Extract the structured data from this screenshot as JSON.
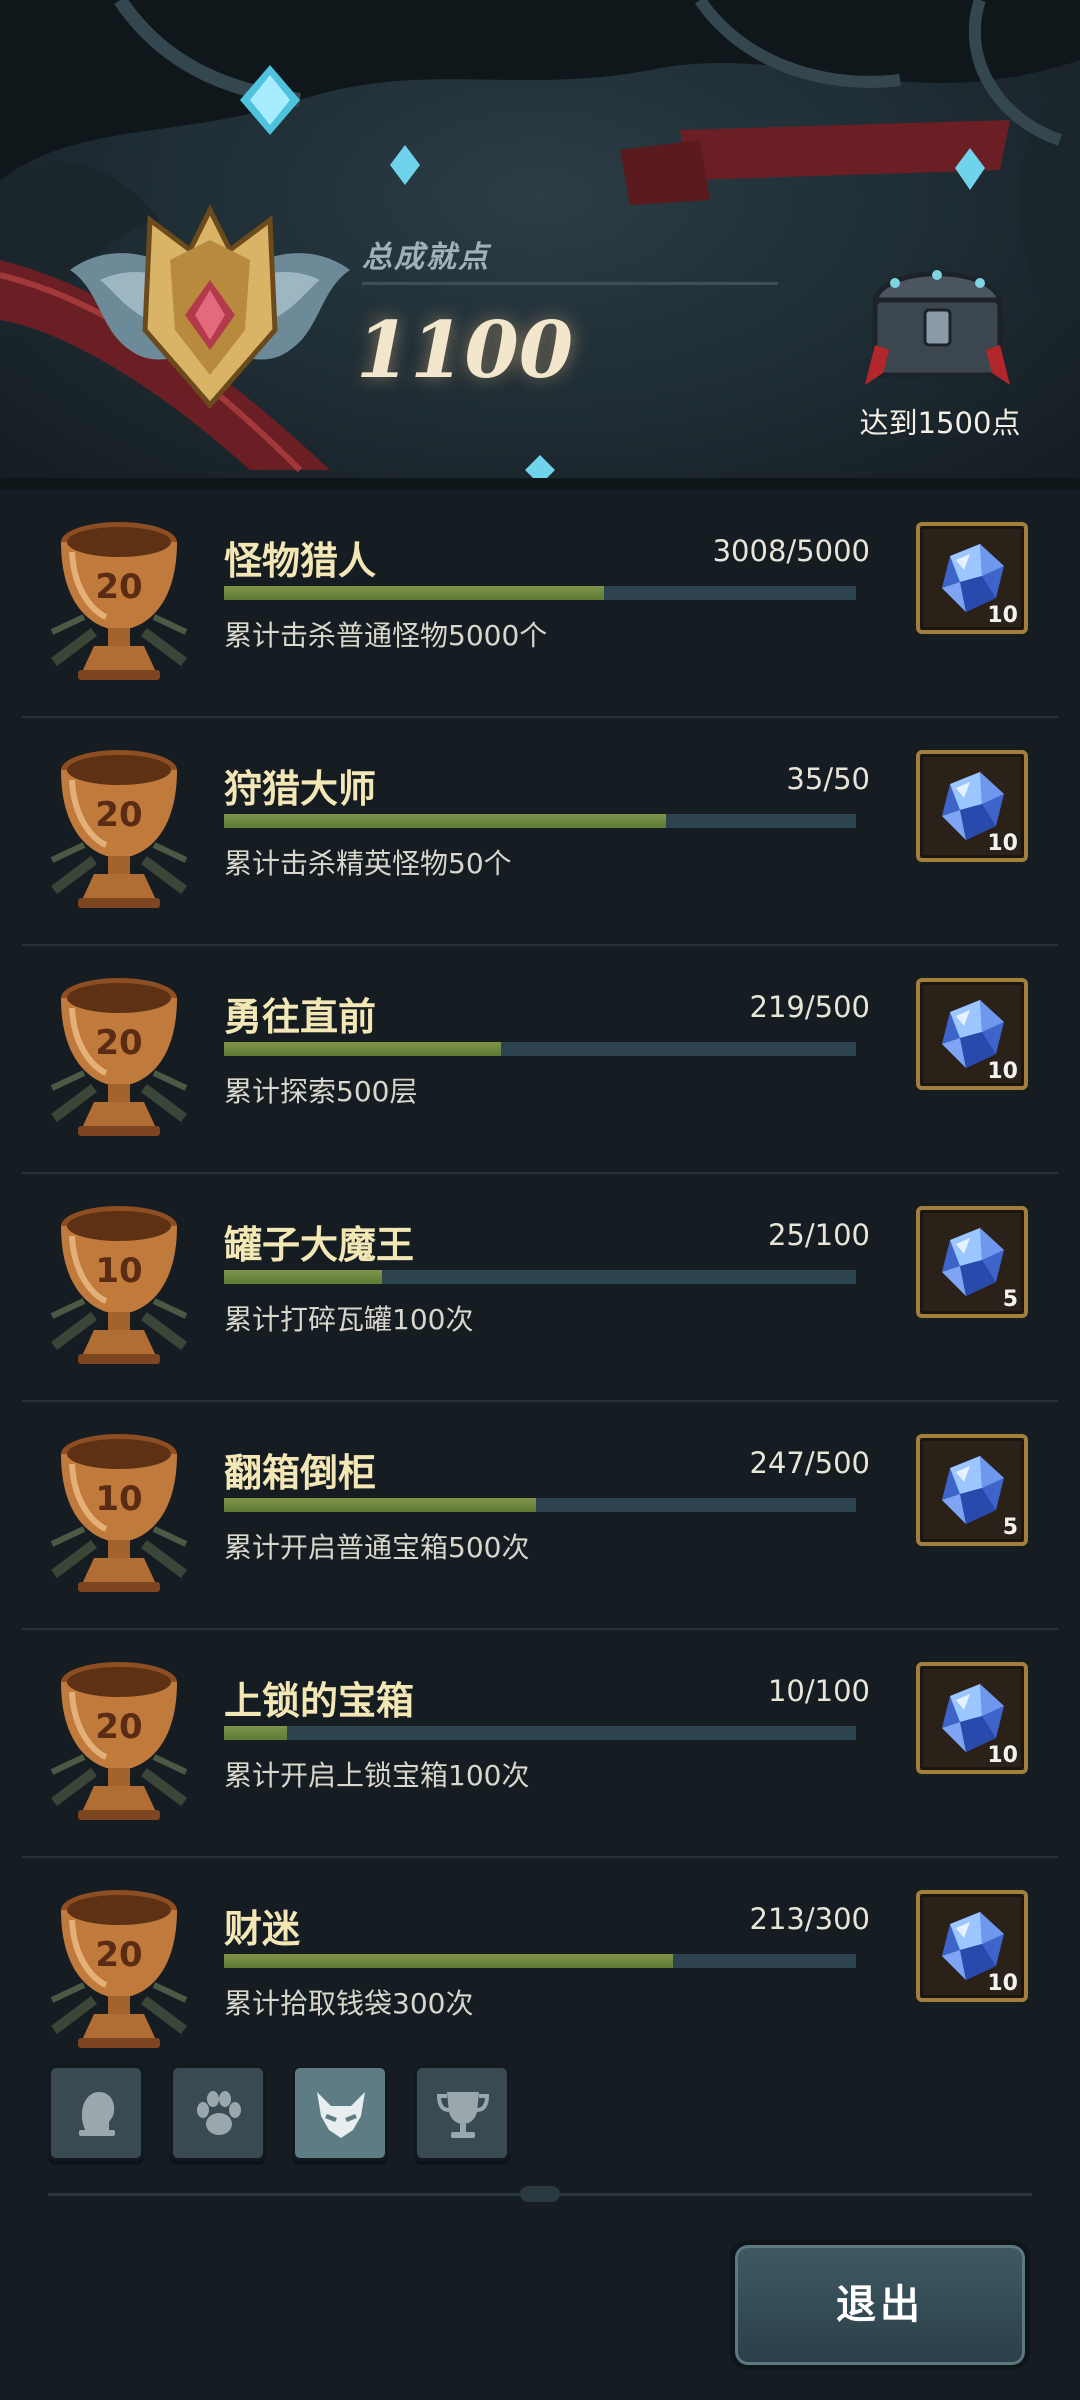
{
  "header": {
    "total_label": "总成就点",
    "total_value": "1100",
    "next_goal": "达到1500点"
  },
  "colors": {
    "progress_fill": "#6f8a3f",
    "progress_track": "#2d4350",
    "title_text": "#f3e7b6",
    "trophy_bronze": "#c07a3c"
  },
  "achievements": [
    {
      "points": "20",
      "title": "怪物猎人",
      "progress": "3008/5000",
      "progress_fraction": 0.6016,
      "description": "累计击杀普通怪物5000个",
      "reward_icon": "crystal-icon",
      "reward_qty": "10"
    },
    {
      "points": "20",
      "title": "狩猎大师",
      "progress": "35/50",
      "progress_fraction": 0.7,
      "description": "累计击杀精英怪物50个",
      "reward_icon": "crystal-icon",
      "reward_qty": "10"
    },
    {
      "points": "20",
      "title": "勇往直前",
      "progress": "219/500",
      "progress_fraction": 0.438,
      "description": "累计探索500层",
      "reward_icon": "crystal-icon",
      "reward_qty": "10"
    },
    {
      "points": "10",
      "title": "罐子大魔王",
      "progress": "25/100",
      "progress_fraction": 0.25,
      "description": "累计打碎瓦罐100次",
      "reward_icon": "crystal-icon",
      "reward_qty": "5"
    },
    {
      "points": "10",
      "title": "翻箱倒柜",
      "progress": "247/500",
      "progress_fraction": 0.494,
      "description": "累计开启普通宝箱500次",
      "reward_icon": "crystal-icon",
      "reward_qty": "5"
    },
    {
      "points": "20",
      "title": "上锁的宝箱",
      "progress": "10/100",
      "progress_fraction": 0.1,
      "description": "累计开启上锁宝箱100次",
      "reward_icon": "crystal-icon",
      "reward_qty": "10"
    },
    {
      "points": "20",
      "title": "财迷",
      "progress": "213/300",
      "progress_fraction": 0.71,
      "description": "累计拾取钱袋300次",
      "reward_icon": "crystal-icon",
      "reward_qty": "10"
    }
  ],
  "tabs": [
    {
      "icon": "hero-head-icon",
      "active": false
    },
    {
      "icon": "paw-icon",
      "active": false
    },
    {
      "icon": "demon-mask-icon",
      "active": true
    },
    {
      "icon": "trophy-icon",
      "active": false
    }
  ],
  "footer": {
    "exit_label": "退出"
  }
}
